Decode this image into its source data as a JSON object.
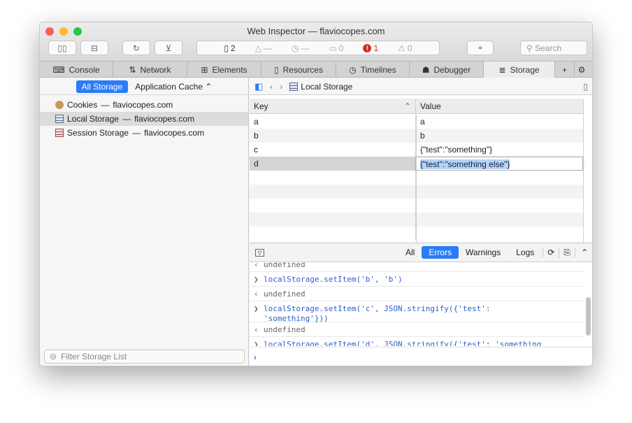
{
  "window": {
    "title": "Web Inspector — flaviocopes.com"
  },
  "toolbar": {
    "resources_count": "2",
    "load_time": "—",
    "timeline": "—",
    "logs": "0",
    "errors": "1",
    "warnings": "0",
    "search_placeholder": "Search"
  },
  "tabs": [
    {
      "label": "Console"
    },
    {
      "label": "Network"
    },
    {
      "label": "Elements"
    },
    {
      "label": "Resources"
    },
    {
      "label": "Timelines"
    },
    {
      "label": "Debugger"
    },
    {
      "label": "Storage"
    }
  ],
  "sidebar": {
    "scope_all": "All Storage",
    "scope_cache": "Application Cache",
    "items": [
      {
        "label": "Cookies",
        "domain": "flaviocopes.com"
      },
      {
        "label": "Local Storage",
        "domain": "flaviocopes.com"
      },
      {
        "label": "Session Storage",
        "domain": "flaviocopes.com"
      }
    ],
    "filter_placeholder": "Filter Storage List"
  },
  "main": {
    "breadcrumb": "Local Storage",
    "columns": {
      "key": "Key",
      "value": "Value"
    },
    "rows": [
      {
        "key": "a",
        "value": "a"
      },
      {
        "key": "b",
        "value": "b"
      },
      {
        "key": "c",
        "value": "{\"test\":\"something\"}"
      },
      {
        "key": "d",
        "value": "{\"test\":\"something else\"}"
      }
    ]
  },
  "console": {
    "filters": {
      "all": "All",
      "errors": "Errors",
      "warnings": "Warnings",
      "logs": "Logs"
    },
    "lines": [
      {
        "type": "result",
        "text": "undefined"
      },
      {
        "type": "input",
        "text": "localStorage.setItem('b', 'b')"
      },
      {
        "type": "result",
        "text": "undefined"
      },
      {
        "type": "input",
        "text": "localStorage.setItem('c', JSON.stringify({'test': 'something'}))"
      },
      {
        "type": "result",
        "text": "undefined"
      },
      {
        "type": "input",
        "text": "localStorage.setItem('d', JSON.stringify({'test': 'something else'}))"
      }
    ]
  }
}
